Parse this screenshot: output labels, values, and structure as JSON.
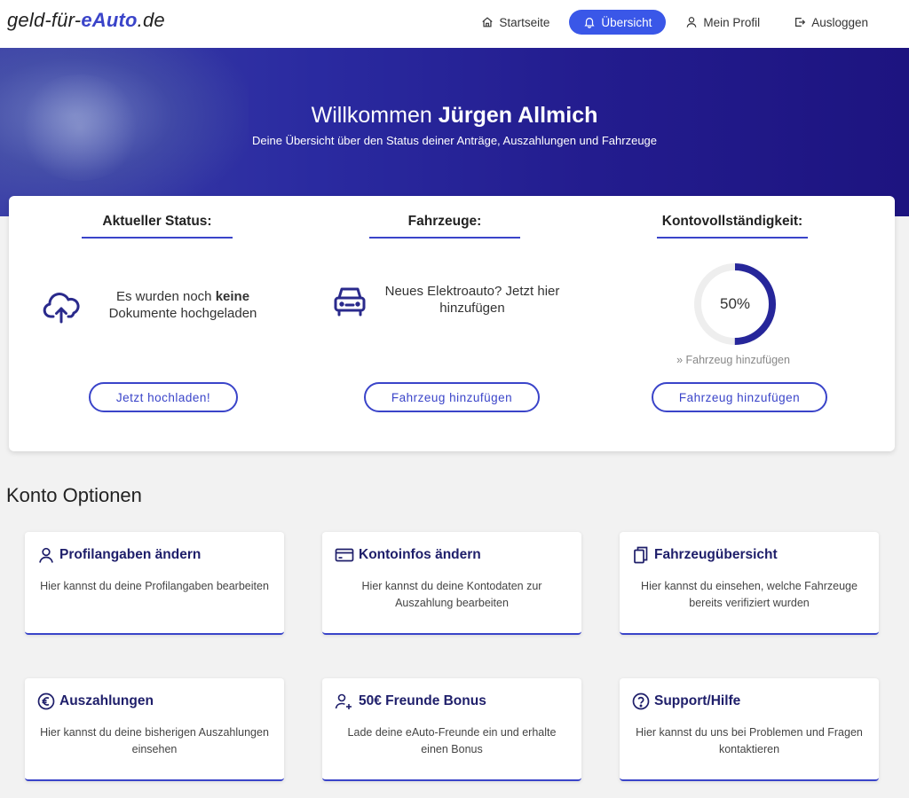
{
  "header": {
    "logo_prefix": "geld-für-",
    "logo_brand": "eAuto",
    "logo_suffix": ".de",
    "nav": [
      {
        "label": "Startseite",
        "icon": "home-icon"
      },
      {
        "label": "Übersicht",
        "icon": "bell-icon",
        "active": true
      },
      {
        "label": "Mein Profil",
        "icon": "user-icon"
      },
      {
        "label": "Ausloggen",
        "icon": "logout-icon"
      }
    ]
  },
  "hero": {
    "greeting": "Willkommen",
    "user_name": "Jürgen Allmich",
    "subtitle": "Deine Übersicht über den Status deiner Anträge, Auszahlungen und Fahrzeuge"
  },
  "status": {
    "current": {
      "title": "Aktueller Status:",
      "text_before": "Es wurden noch ",
      "text_bold": "keine",
      "text_after": "Dokumente hochgeladen",
      "button": "Jetzt hochladen!",
      "icon": "cloud-upload-icon"
    },
    "vehicles": {
      "title": "Fahrzeuge:",
      "text": "Neues Elektroauto? Jetzt hier hinzufügen",
      "button": "Fahrzeug hinzufügen",
      "icon": "car-icon"
    },
    "account": {
      "title": "Kontovollständigkeit:",
      "percent_label": "50%",
      "percent": 50,
      "hint": "» Fahrzeug hinzufügen",
      "button": "Fahrzeug hinzufügen"
    }
  },
  "options": {
    "title": "Konto Optionen",
    "cards": [
      {
        "title": "Profilangaben ändern",
        "desc": "Hier kannst du deine Profilangaben bearbeiten",
        "icon": "user-icon"
      },
      {
        "title": "Kontoinfos ändern",
        "desc": "Hier kannst du deine Kontodaten zur Auszahlung bearbeiten",
        "icon": "credit-card-icon"
      },
      {
        "title": "Fahrzeugübersicht",
        "desc": "Hier kannst du einsehen, welche Fahrzeuge bereits verifiziert wurden",
        "icon": "documents-icon"
      },
      {
        "title": "Auszahlungen",
        "desc": "Hier kannst du deine bisherigen Auszahlungen einsehen",
        "icon": "euro-icon"
      },
      {
        "title": "50€ Freunde Bonus",
        "desc": "Lade deine eAuto-Freunde ein und erhalte einen Bonus",
        "icon": "add-user-icon"
      },
      {
        "title": "Support/Hilfe",
        "desc": "Hier kannst du uns bei Problemen und Fragen kontaktieren",
        "icon": "help-icon"
      }
    ]
  },
  "colors": {
    "accent": "#3a44c9",
    "nav_active": "#3a57e8",
    "hero": "#231c8e"
  }
}
